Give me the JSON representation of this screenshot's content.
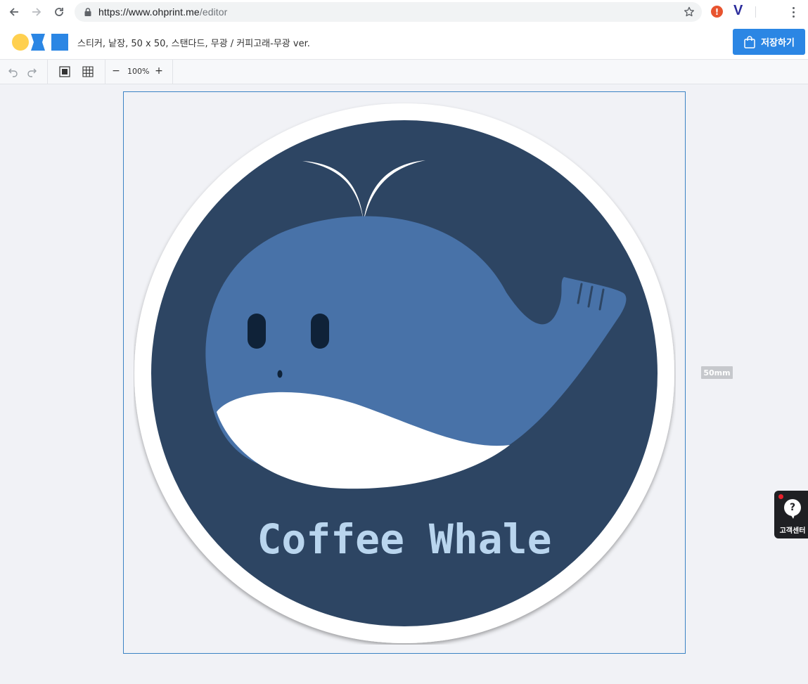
{
  "browser": {
    "url_prefix": "https://www.ohprint.me",
    "url_path": "/editor",
    "ext1_glyph": "!",
    "ext2_glyph": "V",
    "icons": [
      "back-icon",
      "forward-icon",
      "reload-icon",
      "lock-icon",
      "star-icon",
      "kebab-menu-icon"
    ]
  },
  "header": {
    "doc_title": "스티커, 낱장, 50 x 50, 스탠다드, 무광 / 커피고래-무광 ver.",
    "save_label": "저장하기",
    "logo_colors": [
      "#ffd04f",
      "#2b86e4"
    ]
  },
  "toolbar": {
    "zoom_minus": "−",
    "zoom_value": "100%",
    "zoom_plus": "+",
    "icons": [
      "undo-icon",
      "redo-icon",
      "fit-frame-icon",
      "grid-icon"
    ]
  },
  "canvas": {
    "size_label": "50mm",
    "sticker_text": "Coffee Whale",
    "colors": {
      "background_circle": "#2d4563",
      "whale_body": "#4872a8",
      "whale_belly": "#ffffff",
      "eyes": "#0f2238",
      "text": "#b9d5ee",
      "border": "#ffffff"
    }
  },
  "help": {
    "glyph": "?",
    "label": "고객센터"
  },
  "accent": "#2b86e4"
}
